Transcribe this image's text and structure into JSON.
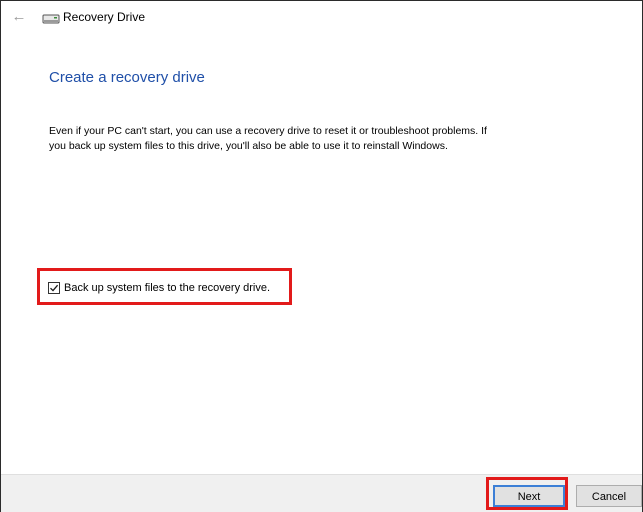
{
  "window": {
    "title": "Recovery Drive",
    "back_icon": "arrow-left-icon",
    "title_icon": "drive-icon"
  },
  "content": {
    "heading": "Create a recovery drive",
    "description_line1": "Even if your PC can't start, you can use a recovery drive to reset it or troubleshoot problems. If",
    "description_line2": "you back up system files to this drive, you'll also be able to use it to reinstall Windows.",
    "backup_checkbox": {
      "label": "Back up system files to the recovery drive.",
      "checked": true
    }
  },
  "footer": {
    "next_label": "Next",
    "cancel_label": "Cancel"
  },
  "colors": {
    "heading": "#1f4fa8",
    "highlight": "#e21a1a",
    "footer_bg": "#f0f0f0",
    "default_button_border": "#3c7fd6"
  }
}
